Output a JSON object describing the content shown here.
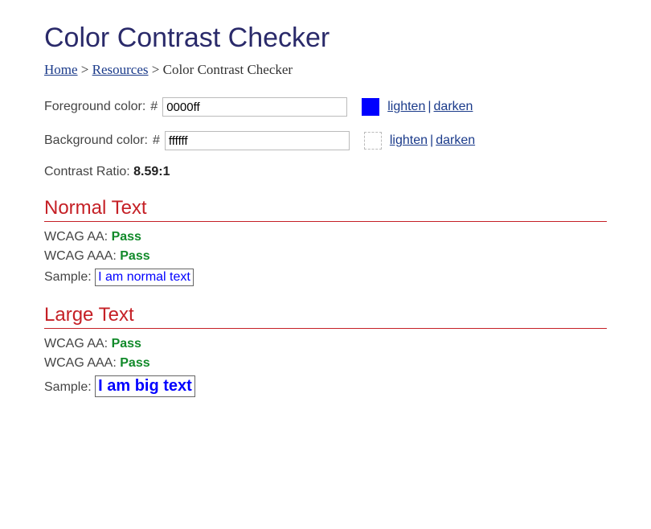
{
  "title": "Color Contrast Checker",
  "breadcrumb": {
    "home": "Home",
    "sep": ">",
    "resources": "Resources",
    "current": "Color Contrast Checker"
  },
  "fg": {
    "label": "Foreground color: ",
    "hash": "#",
    "value": "0000ff",
    "lighten": "lighten",
    "darken": "darken",
    "sep": "|"
  },
  "bg": {
    "label": "Background color: ",
    "hash": "#",
    "value": "ffffff",
    "lighten": "lighten",
    "darken": "darken",
    "sep": "|"
  },
  "ratio": {
    "label": "Contrast Ratio: ",
    "value": "8.59:1"
  },
  "normal": {
    "heading": "Normal Text",
    "aa_label": "WCAG AA: ",
    "aa_result": "Pass",
    "aaa_label": "WCAG AAA: ",
    "aaa_result": "Pass",
    "sample_label": "Sample: ",
    "sample_text": "I am normal text"
  },
  "large": {
    "heading": "Large Text",
    "aa_label": "WCAG AA: ",
    "aa_result": "Pass",
    "aaa_label": "WCAG AAA: ",
    "aaa_result": "Pass",
    "sample_label": "Sample: ",
    "sample_text": "I am big text"
  }
}
